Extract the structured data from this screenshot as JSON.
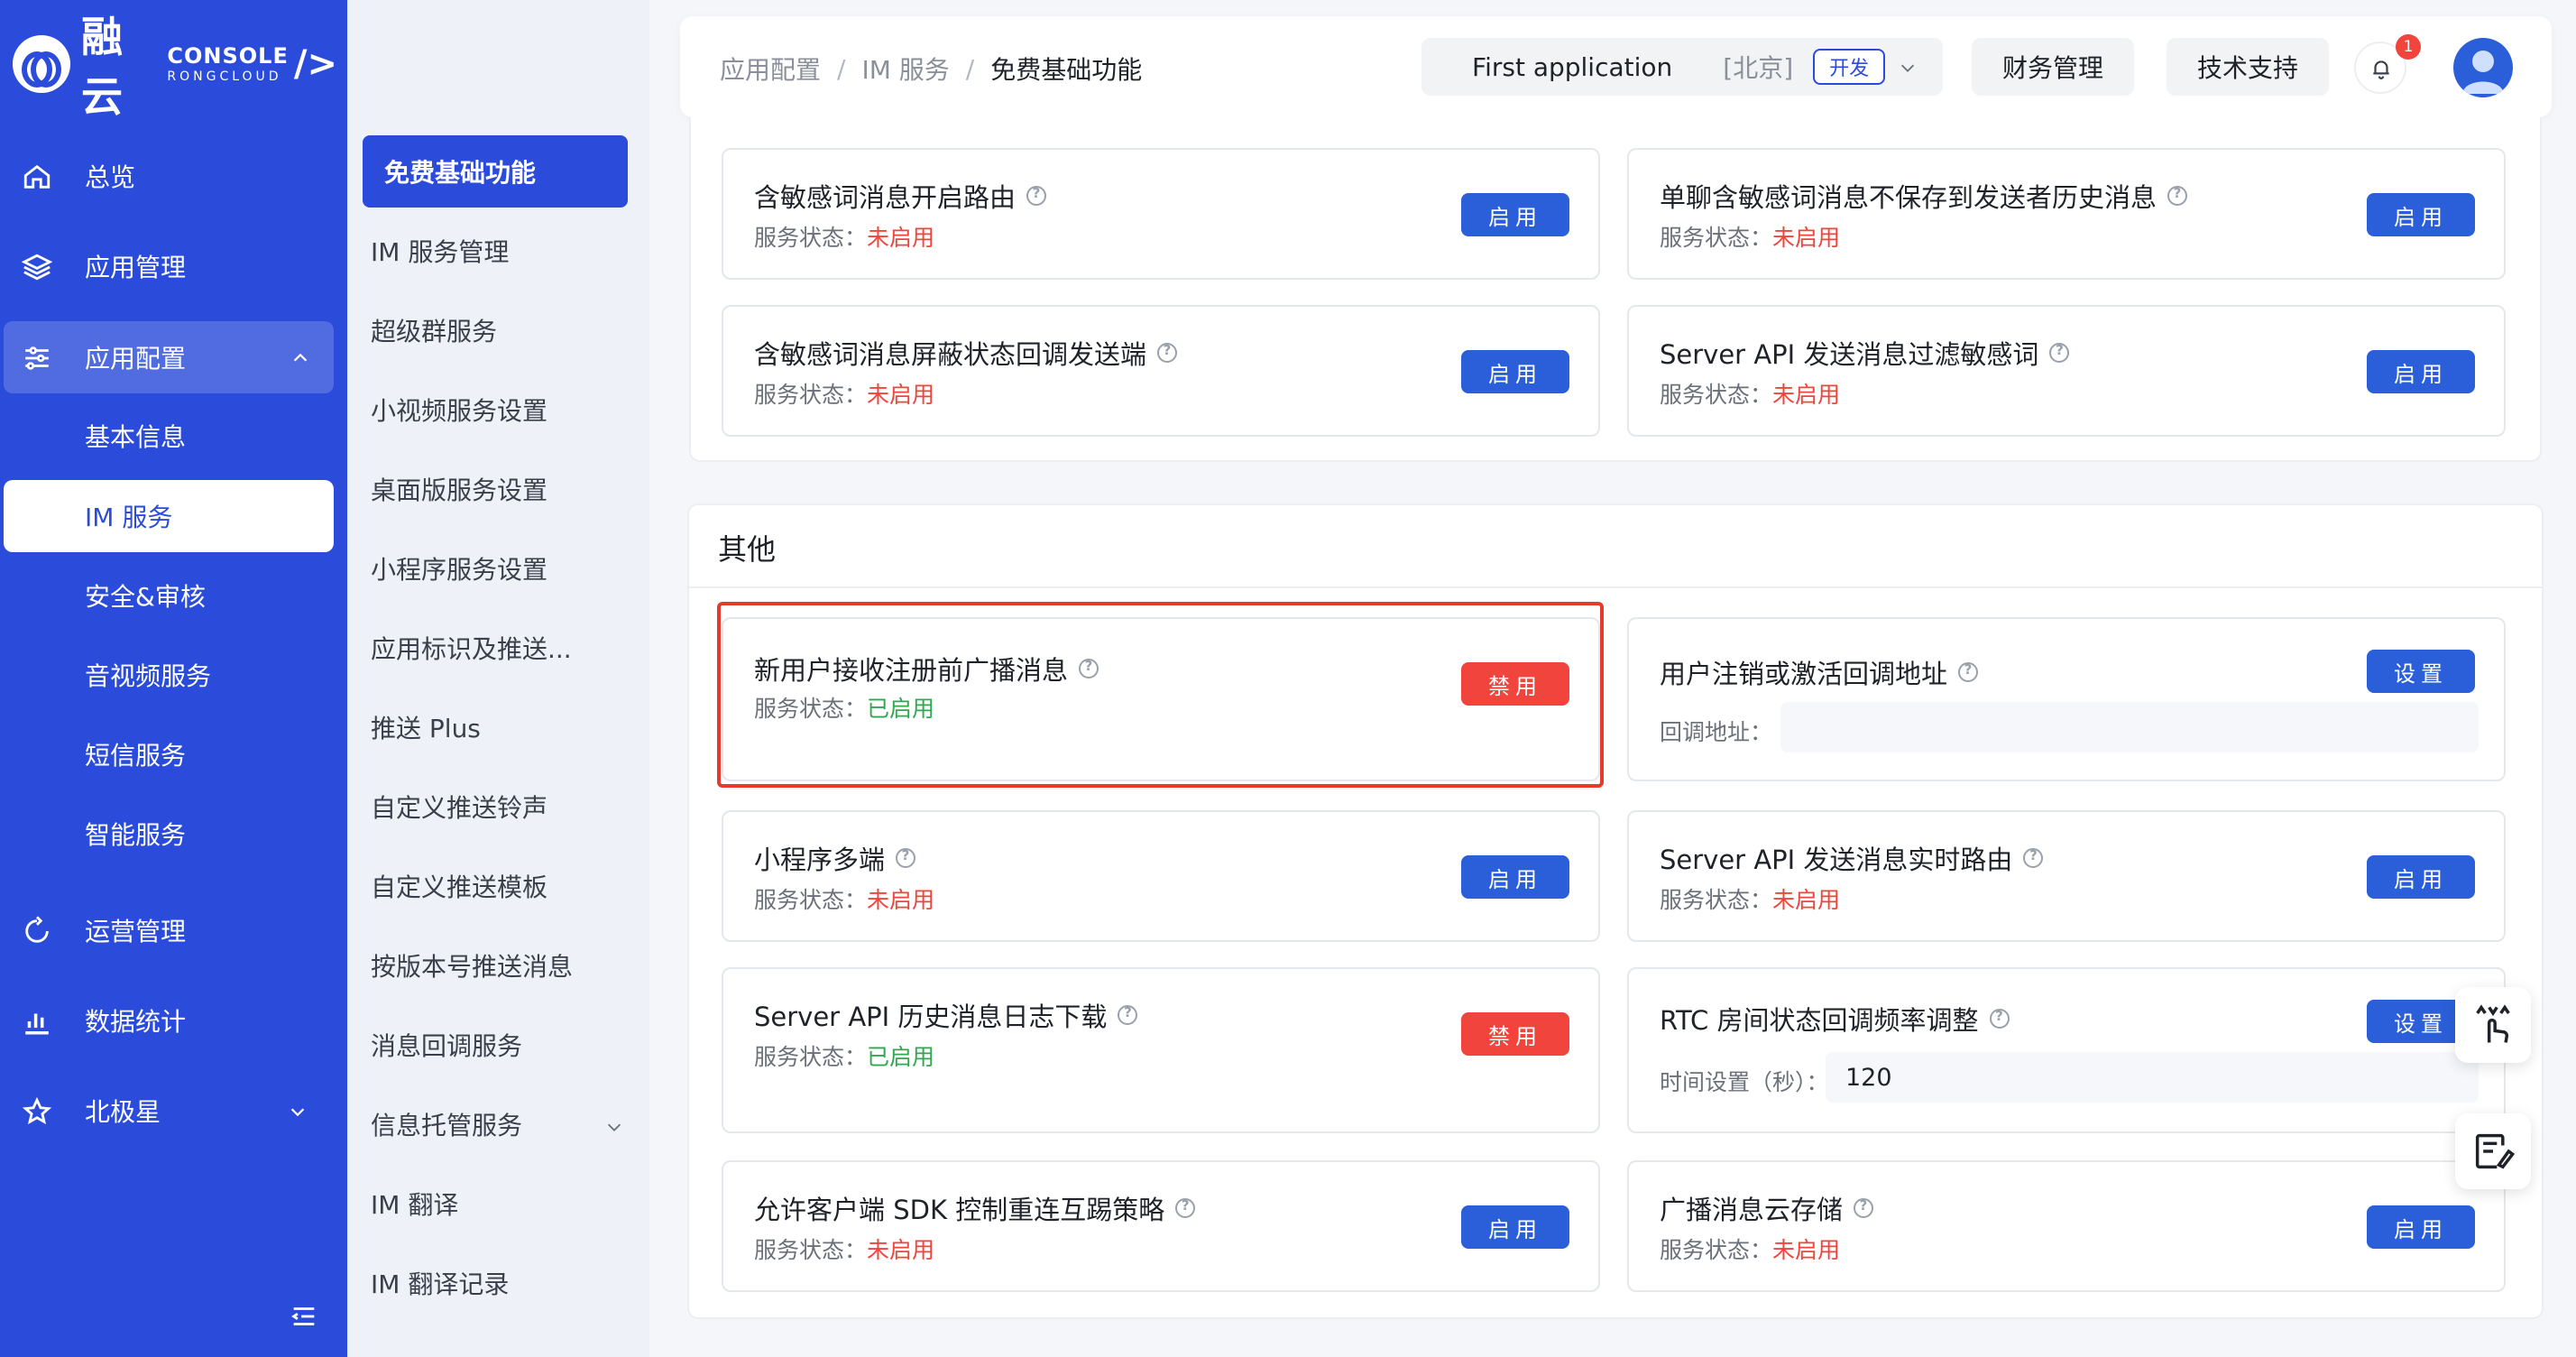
{
  "brand": {
    "cn": "融云",
    "console": "CONSOLE",
    "en": "RONGCLOUD"
  },
  "sidebar": {
    "items": [
      {
        "label": "总览",
        "icon": "home-icon"
      },
      {
        "label": "应用管理",
        "icon": "layers-icon"
      },
      {
        "label": "应用配置",
        "icon": "sliders-icon",
        "expanded": true
      },
      {
        "label": "运营管理",
        "icon": "refresh-icon"
      },
      {
        "label": "数据统计",
        "icon": "bar-chart-icon"
      },
      {
        "label": "北极星",
        "icon": "star-icon"
      }
    ],
    "sub_items": [
      "基本信息",
      "IM 服务",
      "安全&审核",
      "音视频服务",
      "短信服务",
      "智能服务"
    ],
    "active_sub": "IM 服务"
  },
  "submenu": {
    "items": [
      "免费基础功能",
      "IM 服务管理",
      "超级群服务",
      "小视频服务设置",
      "桌面版服务设置",
      "小程序服务设置",
      "应用标识及推送...",
      "推送 Plus",
      "自定义推送铃声",
      "自定义推送模板",
      "按版本号推送消息",
      "消息回调服务",
      "信息托管服务",
      "IM 翻译",
      "IM 翻译记录"
    ],
    "active": "免费基础功能"
  },
  "header": {
    "breadcrumb": [
      "应用配置",
      "IM 服务",
      "免费基础功能"
    ],
    "app_name": "First application",
    "region": "[北京]",
    "env": "开发",
    "finance": "财务管理",
    "support": "技术支持",
    "notifications": "1"
  },
  "status_label": "服务状态：",
  "states": {
    "off": "未启用",
    "on": "已启用"
  },
  "buttons": {
    "enable": "启用",
    "disable": "禁用",
    "set": "设置"
  },
  "top_cards": [
    {
      "title": "含敏感词消息开启路由",
      "state": "未启用",
      "button": "启用"
    },
    {
      "title": "单聊含敏感词消息不保存到发送者历史消息",
      "state": "未启用",
      "button": "启用"
    },
    {
      "title": "含敏感词消息屏蔽状态回调发送端",
      "state": "未启用",
      "button": "启用"
    },
    {
      "title": "Server API 发送消息过滤敏感词",
      "state": "未启用",
      "button": "启用"
    }
  ],
  "other_section": {
    "title": "其他",
    "cards": [
      {
        "title": "新用户接收注册前广播消息",
        "state": "已启用",
        "button": "禁用"
      },
      {
        "title": "用户注销或激活回调地址",
        "button": "设置",
        "field_label": "回调地址：",
        "field_value": ""
      },
      {
        "title": "小程序多端",
        "state": "未启用",
        "button": "启用"
      },
      {
        "title": "Server API 发送消息实时路由",
        "state": "未启用",
        "button": "启用"
      },
      {
        "title": "Server API 历史消息日志下载",
        "state": "已启用",
        "button": "禁用"
      },
      {
        "title": "RTC 房间状态回调频率调整",
        "button": "设置",
        "field_label": "时间设置（秒）：",
        "field_value": "120"
      },
      {
        "title": "允许客户端 SDK 控制重连互踢策略",
        "state": "未启用",
        "button": "启用"
      },
      {
        "title": "广播消息云存储",
        "state": "未启用",
        "button": "启用"
      }
    ]
  },
  "colors": {
    "primary": "#2b4bdb",
    "button_blue": "#2b5fd9",
    "danger": "#f0443c",
    "success": "#2fa84f"
  }
}
